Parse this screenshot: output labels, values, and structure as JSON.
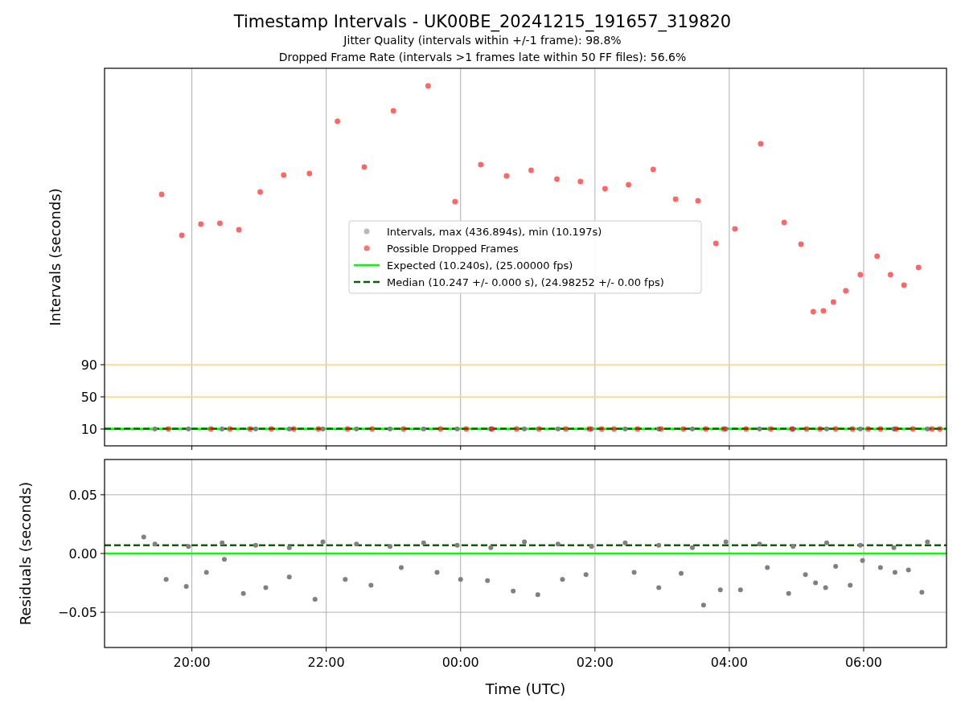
{
  "title": "Timestamp Intervals - UK00BE_20241215_191657_319820",
  "subtitles": [
    "Jitter Quality (intervals within +/-1 frame): 98.8%",
    "Dropped Frame Rate (intervals >1 frames late within 50 FF files): 56.6%"
  ],
  "plots": [
    {
      "chart_data": {
        "type": "scatter",
        "ylabel": "Intervals (seconds)",
        "xlim": [
          "2024-12-15T18:42",
          "2024-12-16T07:14"
        ],
        "ylim": [
          -11,
          459
        ],
        "grid": "x",
        "legend": true,
        "yticks": [
          {
            "value": 10,
            "label": "10"
          },
          {
            "value": 50,
            "label": "50"
          },
          {
            "value": 90,
            "label": "90"
          }
        ],
        "series": [
          {
            "color": "#ffd27f",
            "type": "line",
            "x": [
              "2024-12-15T18:42",
              "2024-12-16T07:14"
            ],
            "values": [
              50,
              50
            ]
          },
          {
            "color": "#ffd27f",
            "type": "line",
            "x": [
              "2024-12-15T18:42",
              "2024-12-16T07:14"
            ],
            "values": [
              90,
              90
            ]
          },
          {
            "name": "Intervals, max (436.894s), min (10.197s)",
            "color": "#808080",
            "x": [
              "2024-12-15T19:27",
              "2024-12-15T19:57",
              "2024-12-15T20:27",
              "2024-12-15T20:57",
              "2024-12-15T21:27",
              "2024-12-15T21:57",
              "2024-12-15T22:27",
              "2024-12-15T22:57",
              "2024-12-15T23:27",
              "2024-12-15T23:57",
              "2024-12-16T00:27",
              "2024-12-16T00:57",
              "2024-12-16T01:27",
              "2024-12-16T01:57",
              "2024-12-16T02:27",
              "2024-12-16T02:57",
              "2024-12-16T03:27",
              "2024-12-16T03:57",
              "2024-12-16T04:27",
              "2024-12-16T04:57",
              "2024-12-16T05:27",
              "2024-12-16T05:57",
              "2024-12-16T06:27",
              "2024-12-16T06:57"
            ],
            "values": [
              10,
              10,
              10,
              10,
              10,
              10,
              10,
              10,
              10,
              10,
              10,
              10,
              10,
              10,
              10,
              10,
              10,
              10,
              10,
              10,
              10,
              10,
              10,
              10
            ]
          },
          {
            "name": "Possible Dropped Frames",
            "color": "#ff0000",
            "x": [
              "2024-12-15T19:33",
              "2024-12-15T19:51",
              "2024-12-15T20:08",
              "2024-12-15T20:25",
              "2024-12-15T20:42",
              "2024-12-15T21:01",
              "2024-12-15T21:22",
              "2024-12-15T21:45",
              "2024-12-15T22:10",
              "2024-12-15T22:34",
              "2024-12-15T23:00",
              "2024-12-15T23:31",
              "2024-12-15T23:55",
              "2024-12-16T00:18",
              "2024-12-16T00:41",
              "2024-12-16T01:03",
              "2024-12-16T01:26",
              "2024-12-16T01:47",
              "2024-12-16T02:09",
              "2024-12-16T02:30",
              "2024-12-16T02:52",
              "2024-12-16T03:12",
              "2024-12-16T03:32",
              "2024-12-16T03:48",
              "2024-12-16T04:05",
              "2024-12-16T04:28",
              "2024-12-16T04:49",
              "2024-12-16T05:04",
              "2024-12-16T05:15",
              "2024-12-16T05:24",
              "2024-12-16T05:33",
              "2024-12-16T05:44",
              "2024-12-16T05:57",
              "2024-12-16T06:12",
              "2024-12-16T06:24",
              "2024-12-16T06:36",
              "2024-12-16T06:49",
              "2024-12-15T19:39",
              "2024-12-15T20:17",
              "2024-12-15T20:34",
              "2024-12-15T20:52",
              "2024-12-15T21:11",
              "2024-12-15T21:31",
              "2024-12-15T21:53",
              "2024-12-15T22:19",
              "2024-12-15T22:41",
              "2024-12-15T23:09",
              "2024-12-15T23:42",
              "2024-12-16T00:05",
              "2024-12-16T00:28",
              "2024-12-16T00:50",
              "2024-12-16T01:10",
              "2024-12-16T01:34",
              "2024-12-16T01:55",
              "2024-12-16T02:06",
              "2024-12-16T02:17",
              "2024-12-16T02:38",
              "2024-12-16T02:59",
              "2024-12-16T03:19",
              "2024-12-16T03:39",
              "2024-12-16T03:55",
              "2024-12-16T04:15",
              "2024-12-16T04:37",
              "2024-12-16T04:56",
              "2024-12-16T05:09",
              "2024-12-16T05:21",
              "2024-12-16T05:35",
              "2024-12-16T05:50",
              "2024-12-16T06:04",
              "2024-12-16T06:15",
              "2024-12-16T06:29",
              "2024-12-16T06:44",
              "2024-12-16T07:01",
              "2024-12-16T07:08"
            ],
            "values": [
              302,
              251,
              265,
              266,
              258,
              305,
              326,
              328,
              393,
              336,
              406,
              437,
              293,
              339,
              325,
              332,
              321,
              318,
              309,
              314,
              333,
              296,
              294,
              241,
              259,
              365,
              267,
              240,
              156,
              157,
              168,
              182,
              202,
              225,
              202,
              189,
              211,
              10,
              10,
              10,
              10,
              10,
              10,
              10,
              10,
              10,
              10,
              10,
              10,
              10,
              10,
              10,
              10,
              10,
              10,
              10,
              10,
              10,
              10,
              10,
              10,
              10,
              10,
              10,
              10,
              10,
              10,
              10,
              10,
              10,
              10,
              10,
              10,
              10
            ]
          },
          {
            "name": "Expected (10.240s), (25.00000 fps)",
            "color": "#00ff00",
            "type": "line",
            "x": [
              "2024-12-15T18:42",
              "2024-12-16T07:14"
            ],
            "values": [
              10.24,
              10.24
            ]
          },
          {
            "name": "Median (10.247 +/- 0.000 s), (24.98252 +/- 0.00 fps)",
            "color": "#006400",
            "type": "line",
            "line_style": "dashed",
            "x": [
              "2024-12-15T18:42",
              "2024-12-16T07:14"
            ],
            "values": [
              10.247,
              10.247
            ]
          }
        ]
      }
    },
    {
      "chart_data": {
        "type": "scatter",
        "xlabel": "Time (UTC)",
        "ylabel": "Residuals (seconds)",
        "xlim": [
          "2024-12-15T18:42",
          "2024-12-16T07:14"
        ],
        "ylim": [
          -0.08,
          0.08
        ],
        "grid": "both",
        "xticks": [
          {
            "value": "2024-12-15T20:00",
            "label": "20:00"
          },
          {
            "value": "2024-12-15T22:00",
            "label": "22:00"
          },
          {
            "value": "2024-12-16T00:00",
            "label": "00:00"
          },
          {
            "value": "2024-12-16T02:00",
            "label": "02:00"
          },
          {
            "value": "2024-12-16T04:00",
            "label": "04:00"
          },
          {
            "value": "2024-12-16T06:00",
            "label": "06:00"
          }
        ],
        "yticks": [
          {
            "value": 0.05,
            "label": "0.05"
          },
          {
            "value": 0,
            "label": "0.00"
          },
          {
            "value": -0.05,
            "label": "−0.05"
          }
        ],
        "series": [
          {
            "color": "#808080",
            "x": [
              "2024-12-15T19:17",
              "2024-12-15T19:37",
              "2024-12-15T19:55",
              "2024-12-15T20:13",
              "2024-12-15T20:29",
              "2024-12-15T20:46",
              "2024-12-15T21:06",
              "2024-12-15T21:27",
              "2024-12-15T21:50",
              "2024-12-15T22:17",
              "2024-12-15T22:40",
              "2024-12-15T23:07",
              "2024-12-15T23:39",
              "2024-12-16T00:00",
              "2024-12-16T00:24",
              "2024-12-16T00:47",
              "2024-12-16T01:09",
              "2024-12-16T01:31",
              "2024-12-16T01:52",
              "2024-12-16T02:35",
              "2024-12-16T02:57",
              "2024-12-16T03:17",
              "2024-12-16T03:37",
              "2024-12-16T03:52",
              "2024-12-16T04:10",
              "2024-12-16T04:34",
              "2024-12-16T04:53",
              "2024-12-16T05:08",
              "2024-12-16T05:17",
              "2024-12-16T05:26",
              "2024-12-16T05:35",
              "2024-12-16T05:48",
              "2024-12-16T05:59",
              "2024-12-16T06:15",
              "2024-12-16T06:28",
              "2024-12-16T06:40",
              "2024-12-16T06:52",
              "2024-12-15T19:27",
              "2024-12-15T19:57",
              "2024-12-15T20:27",
              "2024-12-15T20:57",
              "2024-12-15T21:27",
              "2024-12-15T21:57",
              "2024-12-15T22:27",
              "2024-12-15T22:57",
              "2024-12-15T23:27",
              "2024-12-15T23:57",
              "2024-12-16T00:27",
              "2024-12-16T00:57",
              "2024-12-16T01:27",
              "2024-12-16T01:57",
              "2024-12-16T02:27",
              "2024-12-16T02:57",
              "2024-12-16T03:27",
              "2024-12-16T03:57",
              "2024-12-16T04:27",
              "2024-12-16T04:57",
              "2024-12-16T05:27",
              "2024-12-16T05:57",
              "2024-12-16T06:27",
              "2024-12-16T06:57"
            ],
            "values": [
              0.014,
              -0.022,
              -0.028,
              -0.016,
              -0.005,
              -0.034,
              -0.029,
              -0.02,
              -0.039,
              -0.022,
              -0.027,
              -0.012,
              -0.016,
              -0.022,
              -0.023,
              -0.032,
              -0.035,
              -0.022,
              -0.018,
              -0.016,
              -0.029,
              -0.017,
              -0.044,
              -0.031,
              -0.031,
              -0.012,
              -0.034,
              -0.018,
              -0.025,
              -0.029,
              -0.011,
              -0.027,
              -0.006,
              -0.012,
              -0.016,
              -0.014,
              -0.033,
              0.008,
              0.006,
              0.009,
              0.007,
              0.005,
              0.01,
              0.008,
              0.006,
              0.009,
              0.007,
              0.005,
              0.01,
              0.008,
              0.006,
              0.009,
              0.007,
              0.005,
              0.01,
              0.008,
              0.006,
              0.009,
              0.007,
              0.005,
              0.01
            ]
          },
          {
            "color": "#00ff00",
            "type": "line",
            "x": [
              "2024-12-15T18:42",
              "2024-12-16T07:14"
            ],
            "values": [
              0,
              0
            ]
          },
          {
            "color": "#006400",
            "type": "line",
            "line_style": "dashed",
            "x": [
              "2024-12-15T18:42",
              "2024-12-16T07:14"
            ],
            "values": [
              0.007,
              0.007
            ]
          }
        ]
      }
    }
  ]
}
